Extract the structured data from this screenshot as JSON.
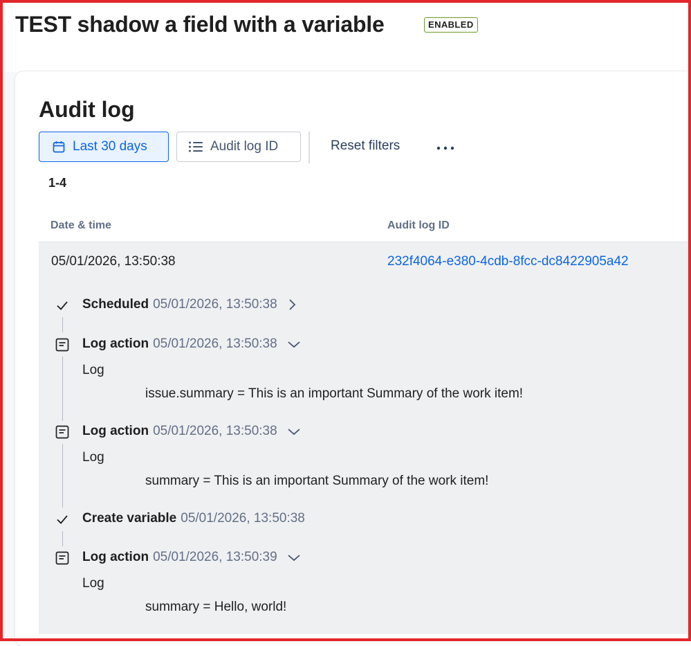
{
  "header": {
    "title": "TEST shadow a field with a variable",
    "status": "ENABLED"
  },
  "audit": {
    "title": "Audit log",
    "filters": {
      "date_label": "Last 30 days",
      "id_label": "Audit log ID",
      "reset_label": "Reset filters"
    },
    "count": "1-4",
    "columns": [
      "Date & time",
      "Audit log ID"
    ],
    "row": {
      "date": "05/01/2026, 13:50:38",
      "id": "232f4064-e380-4cdb-8fcc-dc8422905a42"
    },
    "steps": [
      {
        "name": "Scheduled",
        "time": "05/01/2026, 13:50:38",
        "icon": "check-icon",
        "chevron": "chevron-right-icon"
      },
      {
        "name": "Log action",
        "time": "05/01/2026, 13:50:38",
        "icon": "log-icon",
        "chevron": "chevron-down-icon",
        "label": "Log",
        "message": "issue.summary = This is an important Summary of the work item!"
      },
      {
        "name": "Log action",
        "time": "05/01/2026, 13:50:38",
        "icon": "log-icon",
        "chevron": "chevron-down-icon",
        "label": "Log",
        "message": "summary = This is an important Summary of the work item!"
      },
      {
        "name": "Create variable",
        "time": "05/01/2026, 13:50:38",
        "icon": "check-icon"
      },
      {
        "name": "Log action",
        "time": "05/01/2026, 13:50:39",
        "icon": "log-icon",
        "chevron": "chevron-down-icon",
        "label": "Log",
        "message": "summary = Hello, world!"
      }
    ]
  },
  "colors": {
    "accent": "#0c66e4",
    "frame": "#e3262a",
    "badge_border": "#6a9a23"
  }
}
